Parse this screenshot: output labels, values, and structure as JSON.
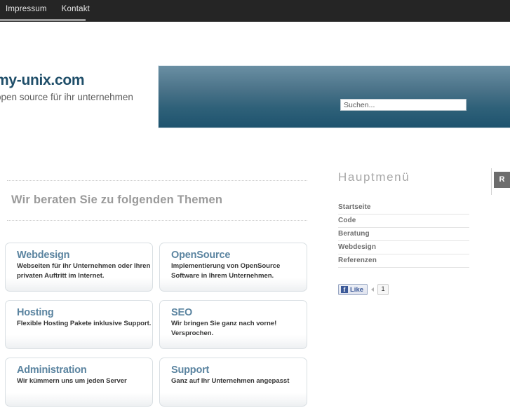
{
  "topnav": {
    "items": [
      {
        "label": "Impressum"
      },
      {
        "label": "Kontakt"
      }
    ]
  },
  "header": {
    "logo": "my-unix.com",
    "tagline": "open source für ihr unternehmen",
    "search": {
      "placeholder": "Suchen...",
      "value": ""
    },
    "panel_gradient_top": "#6a8fa3",
    "panel_gradient_bottom": "#1e536e"
  },
  "main": {
    "page_title": "Wir beraten Sie zu folgenden Themen",
    "boxes": [
      {
        "title": "Webdesign",
        "text": "Webseiten für ihr Unternehmen oder Ihren privaten Auftritt im Internet."
      },
      {
        "title": "OpenSource",
        "text": "Implementierung von OpenSource Software in Ihrem Unternehmen."
      },
      {
        "title": "Hosting",
        "text": "Flexible Hosting Pakete inklusive Support."
      },
      {
        "title": "SEO",
        "text": "Wir bringen Sie ganz nach vorne! Versprochen."
      },
      {
        "title": "Administration",
        "text": "Wir kümmern uns um jeden Server"
      },
      {
        "title": "Support",
        "text": "Ganz auf Ihr Unternehmen angepasst"
      }
    ],
    "box_title_color": "#5b84a0"
  },
  "sidebar": {
    "title": "Hauptmenü",
    "items": [
      {
        "label": "Startseite"
      },
      {
        "label": "Code"
      },
      {
        "label": "Beratung"
      },
      {
        "label": "Webdesign"
      },
      {
        "label": "Referenzen"
      }
    ],
    "facebook": {
      "icon_letter": "f",
      "like_label": "Like",
      "count": "1",
      "brand_color": "#3b5998"
    }
  },
  "right_tab": {
    "label": "R"
  }
}
